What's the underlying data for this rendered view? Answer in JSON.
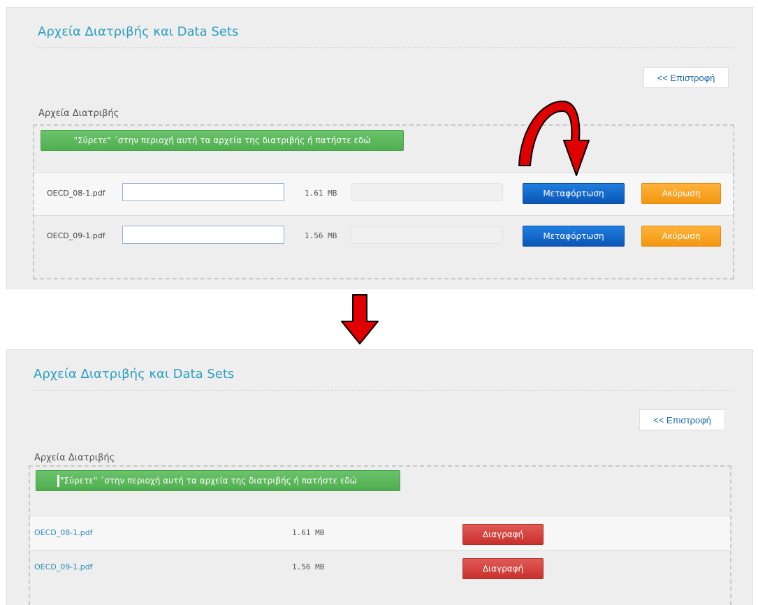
{
  "before": {
    "title": "Αρχεία Διατριβής και Data Sets",
    "back_label": "<< Επιστροφή",
    "section_label": "Αρχεία Διατριβής",
    "dropzone_label": "\"Σύρετε\" ΄στην περιοχή αυτή τα αρχεία της διατριβής ή πατήστε εδώ",
    "files": [
      {
        "name": "OECD_08-1.pdf",
        "size": "1.61 MB",
        "progress": 0,
        "upload_label": "Μεταφόρτωση",
        "cancel_label": "Ακύρωση"
      },
      {
        "name": "OECD_09-1.pdf",
        "size": "1.56 MB",
        "progress": 0,
        "upload_label": "Μεταφόρτωση",
        "cancel_label": "Ακύρωση"
      }
    ]
  },
  "after": {
    "title": "Αρχεία Διατριβής και Data Sets",
    "back_label": "<< Επιστροφή",
    "section_label": "Αρχεία Διατριβής",
    "dropzone_label": "\"Σύρετε\" ΄στην περιοχή αυτή τα αρχεία της διατριβής ή πατήστε εδώ",
    "files": [
      {
        "name": "OECD_08-1.pdf",
        "size": "1.61 MB",
        "delete_label": "Διαγραφή"
      },
      {
        "name": "OECD_09-1.pdf",
        "size": "1.56 MB",
        "delete_label": "Διαγραφή"
      }
    ]
  },
  "colors": {
    "title": "#2a9fc1",
    "upload_button": "#1565d8",
    "cancel_button": "#f7a21f",
    "delete_button": "#d43f3a",
    "dropzone_button": "#5cb85c",
    "annotation_arrow": "#e00000"
  },
  "icons": [
    "curved-arrow-icon",
    "down-arrow-icon"
  ]
}
